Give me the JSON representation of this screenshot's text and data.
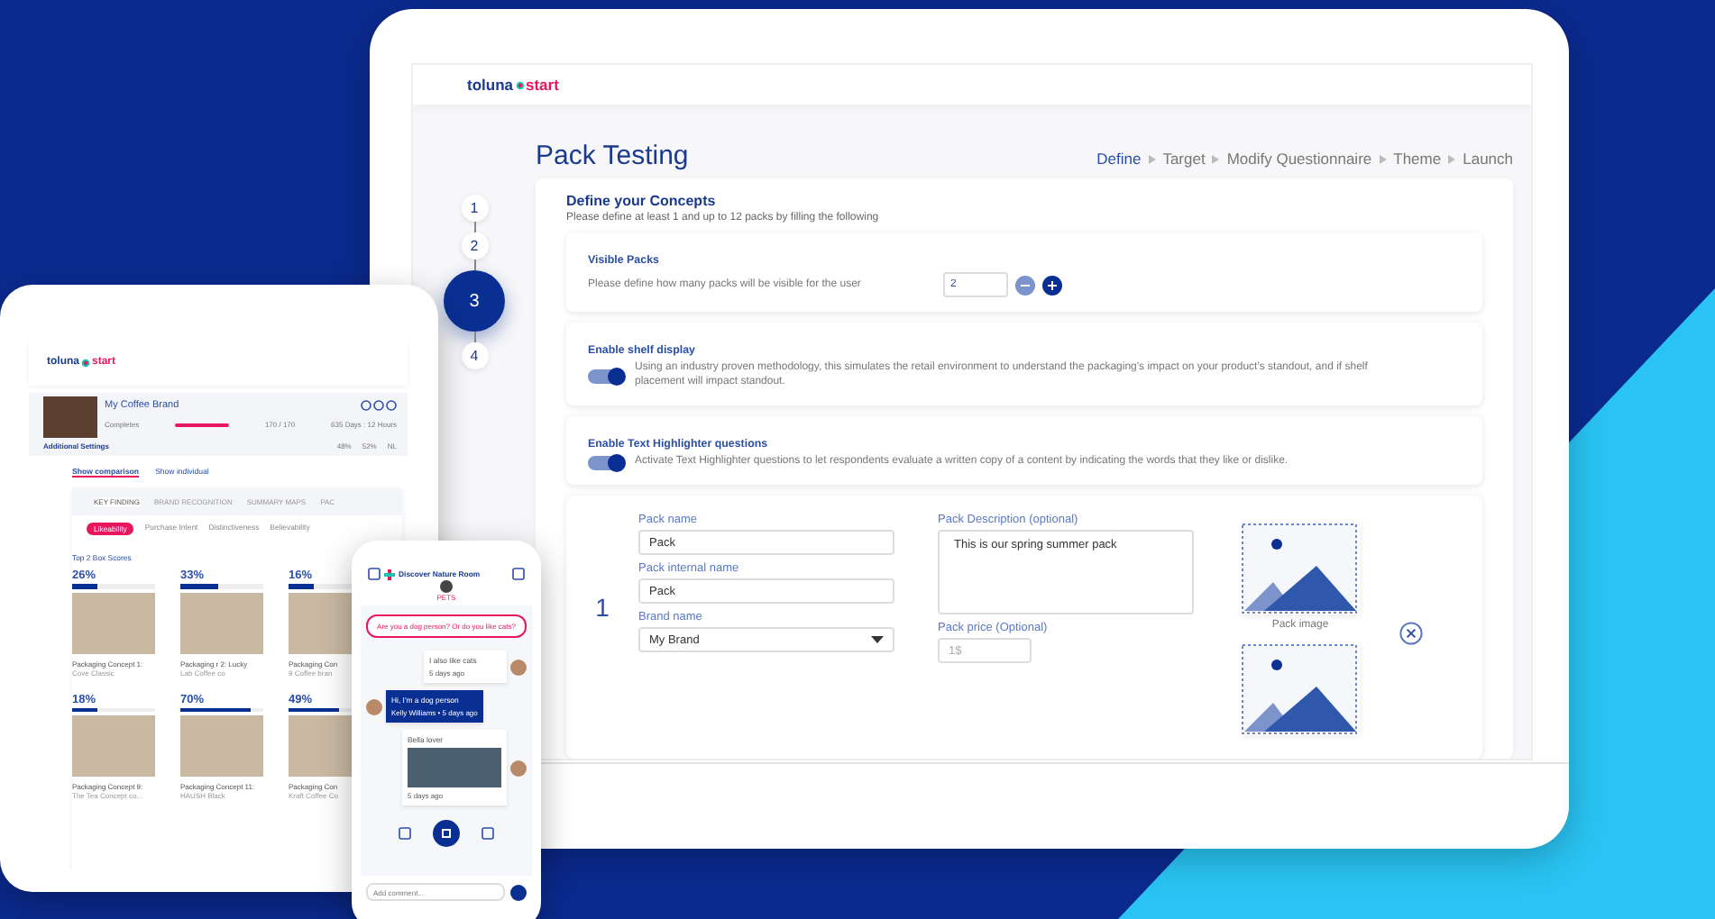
{
  "laptop": {
    "logo": {
      "left": "toluna",
      "right": "start"
    },
    "title": "Pack Testing",
    "breadcrumb": [
      {
        "label": "Define",
        "selected": true
      },
      {
        "label": "Target",
        "selected": false
      },
      {
        "label": "Modify Questionnaire",
        "selected": false
      },
      {
        "label": "Theme",
        "selected": false
      },
      {
        "label": "Launch",
        "selected": false
      }
    ],
    "steps": [
      {
        "label": "1",
        "selected": false
      },
      {
        "label": "2",
        "selected": false
      },
      {
        "label": "3",
        "selected": true
      },
      {
        "label": "4",
        "selected": false
      }
    ],
    "section": {
      "heading": "Define your Concepts",
      "subtitle": "Please define at least 1 and up to 12 packs by filling the following"
    },
    "settings": [
      {
        "kind": "stepper",
        "title": "Visible Packs",
        "text": "Please define how many packs will be visible for the user",
        "value": "2"
      },
      {
        "kind": "toggle",
        "title": "Enable shelf display",
        "text": "Using an industry proven methodology, this simulates the retail environment to understand the packaging's impact on your product's standout, and if shelf placement will impact standout.",
        "on": true
      },
      {
        "kind": "toggle",
        "title": "Enable Text Highlighter questions",
        "text": "Activate Text Highlighter questions to let respondents evaluate a written copy of a content by indicating the words that they like or dislike.",
        "on": true
      }
    ],
    "pack": {
      "number": "1",
      "name_label": "Pack name",
      "name": "Pack",
      "internal_label": "Pack internal name",
      "internal": "Pack",
      "brand_label": "Brand name",
      "brand": "My Brand",
      "description_label": "Pack Description (optional)",
      "description": "This is our spring summer pack",
      "price_label": "Pack price (Optional)",
      "price_placeholder": "1$",
      "image_label": "Pack image"
    }
  },
  "tablet": {
    "logo": {
      "left": "toluna",
      "right": "start"
    },
    "brand": {
      "name": "My Coffee Brand",
      "completes_label": "Completes",
      "level": 1,
      "completes": "170 / 170",
      "duration": "635 Days : 12 Hours",
      "settings_link": "Additional Settings",
      "stats": [
        "48%",
        "52%",
        "NL"
      ]
    },
    "views": [
      {
        "label": "Show comparison",
        "selected": true
      },
      {
        "label": "Show individual",
        "selected": false
      }
    ],
    "tabs": [
      {
        "label": "KEY FINDING",
        "selected": true
      },
      {
        "label": "BRAND RECOGNITION",
        "selected": false
      },
      {
        "label": "SUMMARY MAPS",
        "selected": false
      },
      {
        "label": "PAC",
        "selected": false
      }
    ],
    "subtabs": [
      {
        "label": "Likeability",
        "selected": true
      },
      {
        "label": "Purchase Intent",
        "selected": false
      },
      {
        "label": "Distinctiveness",
        "selected": false
      },
      {
        "label": "Believability",
        "selected": false
      }
    ],
    "scores_title": "Top 2 Box Scores",
    "concepts": [
      {
        "score": "26%",
        "level": 0.3,
        "title": "Packaging Concept 1:",
        "subtitle": "Cove Classic"
      },
      {
        "score": "33%",
        "level": 0.45,
        "title": "Packaging r 2: Lucky",
        "subtitle": "Lab Coffee co"
      },
      {
        "score": "16%",
        "level": 0.3,
        "title": "Packaging Con",
        "subtitle": "9 Coffee bran"
      },
      {
        "score": "18%",
        "level": 0.3,
        "title": "Packaging Concept 9:",
        "subtitle": "The Tea Concept co..."
      },
      {
        "score": "70%",
        "level": 0.85,
        "title": "Packaging Concept 11:",
        "subtitle": "HAUSH Black"
      },
      {
        "score": "49%",
        "level": 0.6,
        "title": "Packaging Con",
        "subtitle": "Kraft Coffee Co"
      }
    ]
  },
  "phone": {
    "room": "Discover Nature Room",
    "topic": "PETS",
    "question": "Are you a dog person? Or do you like cats?",
    "messages": [
      {
        "kind": "text",
        "mine": false,
        "text": "I also like cats",
        "meta": "5 days ago"
      },
      {
        "kind": "text",
        "mine": true,
        "text": "Hi, I'm a dog person",
        "meta": "Kelly Williams • 5 days ago"
      },
      {
        "kind": "image",
        "mine": false,
        "text": "Bella lover",
        "meta": "5 days ago"
      }
    ],
    "comment_placeholder": "Add comment..."
  }
}
